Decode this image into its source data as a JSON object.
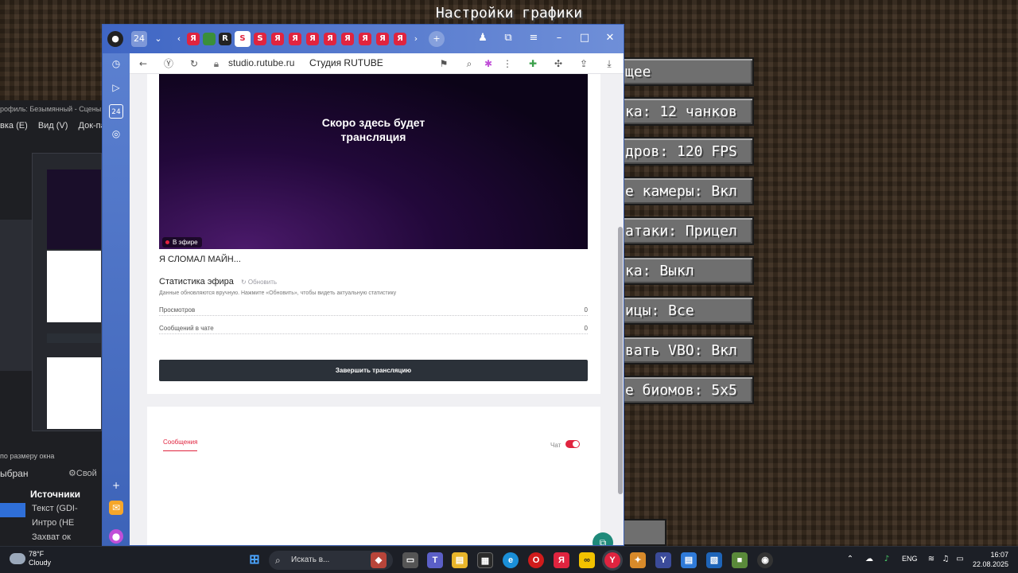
{
  "minecraft": {
    "title": "Настройки графики",
    "buttons": [
      "щее",
      "ка: 12 чанков",
      "дров: 120 FPS",
      "е камеры: Вкл",
      "атаки: Прицел",
      "ка: Выкл",
      "ицы: Все",
      "вать VBO: Вкл",
      "е биомов: 5x5"
    ]
  },
  "obs": {
    "title": "рофиль: Безымянный - Сцены: б",
    "menu": [
      "вка (E)",
      "Вид (V)",
      "Док-па"
    ],
    "fit_label": "по размеру окна",
    "scene_selected": "ыбран",
    "properties_label": "Свой",
    "sources_title": "Источники",
    "sources": [
      "Текст (GDI-",
      "Интро (HE",
      "Захват ок"
    ]
  },
  "browser": {
    "url": "studio.rutube.ru",
    "page_title": "Студия RUTUBE",
    "tab_favicon_letter": "Я",
    "video": {
      "placeholder": "Скоро здесь будет\nтрансляция",
      "live_badge": "В эфире"
    },
    "stream_title": "Я СЛОМАЛ МАЙН...",
    "stats": {
      "heading": "Статистика эфира",
      "refresh": "Обновить",
      "note": "Данные обновляются вручную. Нажмите «Обновить», чтобы видеть актуальную статистику",
      "rows": [
        {
          "label": "Просмотров",
          "value": "0"
        },
        {
          "label": "Сообщений в чате",
          "value": "0"
        }
      ]
    },
    "end_button": "Завершить трансляцию",
    "messages_tab": "Сообщения",
    "chat_label": "Чат",
    "chat_enabled": true
  },
  "taskbar": {
    "weather_temp": "78°F",
    "weather_desc": "Cloudy",
    "search_placeholder": "Искать в...",
    "language": "ENG",
    "time": "16:07",
    "date": "22.08.2025"
  },
  "colors": {
    "accent": "#e0243f",
    "browser_blue": "#5b7fcf",
    "dark_button": "#2b3139"
  }
}
